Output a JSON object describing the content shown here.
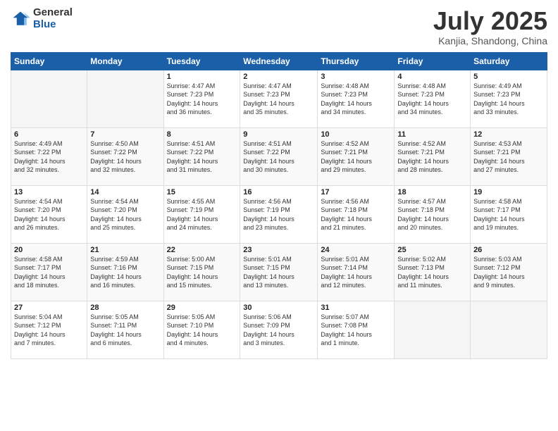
{
  "logo": {
    "general": "General",
    "blue": "Blue"
  },
  "header": {
    "month": "July 2025",
    "location": "Kanjia, Shandong, China"
  },
  "weekdays": [
    "Sunday",
    "Monday",
    "Tuesday",
    "Wednesday",
    "Thursday",
    "Friday",
    "Saturday"
  ],
  "weeks": [
    [
      {
        "day": "",
        "content": ""
      },
      {
        "day": "",
        "content": ""
      },
      {
        "day": "1",
        "content": "Sunrise: 4:47 AM\nSunset: 7:23 PM\nDaylight: 14 hours\nand 36 minutes."
      },
      {
        "day": "2",
        "content": "Sunrise: 4:47 AM\nSunset: 7:23 PM\nDaylight: 14 hours\nand 35 minutes."
      },
      {
        "day": "3",
        "content": "Sunrise: 4:48 AM\nSunset: 7:23 PM\nDaylight: 14 hours\nand 34 minutes."
      },
      {
        "day": "4",
        "content": "Sunrise: 4:48 AM\nSunset: 7:23 PM\nDaylight: 14 hours\nand 34 minutes."
      },
      {
        "day": "5",
        "content": "Sunrise: 4:49 AM\nSunset: 7:23 PM\nDaylight: 14 hours\nand 33 minutes."
      }
    ],
    [
      {
        "day": "6",
        "content": "Sunrise: 4:49 AM\nSunset: 7:22 PM\nDaylight: 14 hours\nand 32 minutes."
      },
      {
        "day": "7",
        "content": "Sunrise: 4:50 AM\nSunset: 7:22 PM\nDaylight: 14 hours\nand 32 minutes."
      },
      {
        "day": "8",
        "content": "Sunrise: 4:51 AM\nSunset: 7:22 PM\nDaylight: 14 hours\nand 31 minutes."
      },
      {
        "day": "9",
        "content": "Sunrise: 4:51 AM\nSunset: 7:22 PM\nDaylight: 14 hours\nand 30 minutes."
      },
      {
        "day": "10",
        "content": "Sunrise: 4:52 AM\nSunset: 7:21 PM\nDaylight: 14 hours\nand 29 minutes."
      },
      {
        "day": "11",
        "content": "Sunrise: 4:52 AM\nSunset: 7:21 PM\nDaylight: 14 hours\nand 28 minutes."
      },
      {
        "day": "12",
        "content": "Sunrise: 4:53 AM\nSunset: 7:21 PM\nDaylight: 14 hours\nand 27 minutes."
      }
    ],
    [
      {
        "day": "13",
        "content": "Sunrise: 4:54 AM\nSunset: 7:20 PM\nDaylight: 14 hours\nand 26 minutes."
      },
      {
        "day": "14",
        "content": "Sunrise: 4:54 AM\nSunset: 7:20 PM\nDaylight: 14 hours\nand 25 minutes."
      },
      {
        "day": "15",
        "content": "Sunrise: 4:55 AM\nSunset: 7:19 PM\nDaylight: 14 hours\nand 24 minutes."
      },
      {
        "day": "16",
        "content": "Sunrise: 4:56 AM\nSunset: 7:19 PM\nDaylight: 14 hours\nand 23 minutes."
      },
      {
        "day": "17",
        "content": "Sunrise: 4:56 AM\nSunset: 7:18 PM\nDaylight: 14 hours\nand 21 minutes."
      },
      {
        "day": "18",
        "content": "Sunrise: 4:57 AM\nSunset: 7:18 PM\nDaylight: 14 hours\nand 20 minutes."
      },
      {
        "day": "19",
        "content": "Sunrise: 4:58 AM\nSunset: 7:17 PM\nDaylight: 14 hours\nand 19 minutes."
      }
    ],
    [
      {
        "day": "20",
        "content": "Sunrise: 4:58 AM\nSunset: 7:17 PM\nDaylight: 14 hours\nand 18 minutes."
      },
      {
        "day": "21",
        "content": "Sunrise: 4:59 AM\nSunset: 7:16 PM\nDaylight: 14 hours\nand 16 minutes."
      },
      {
        "day": "22",
        "content": "Sunrise: 5:00 AM\nSunset: 7:15 PM\nDaylight: 14 hours\nand 15 minutes."
      },
      {
        "day": "23",
        "content": "Sunrise: 5:01 AM\nSunset: 7:15 PM\nDaylight: 14 hours\nand 13 minutes."
      },
      {
        "day": "24",
        "content": "Sunrise: 5:01 AM\nSunset: 7:14 PM\nDaylight: 14 hours\nand 12 minutes."
      },
      {
        "day": "25",
        "content": "Sunrise: 5:02 AM\nSunset: 7:13 PM\nDaylight: 14 hours\nand 11 minutes."
      },
      {
        "day": "26",
        "content": "Sunrise: 5:03 AM\nSunset: 7:12 PM\nDaylight: 14 hours\nand 9 minutes."
      }
    ],
    [
      {
        "day": "27",
        "content": "Sunrise: 5:04 AM\nSunset: 7:12 PM\nDaylight: 14 hours\nand 7 minutes."
      },
      {
        "day": "28",
        "content": "Sunrise: 5:05 AM\nSunset: 7:11 PM\nDaylight: 14 hours\nand 6 minutes."
      },
      {
        "day": "29",
        "content": "Sunrise: 5:05 AM\nSunset: 7:10 PM\nDaylight: 14 hours\nand 4 minutes."
      },
      {
        "day": "30",
        "content": "Sunrise: 5:06 AM\nSunset: 7:09 PM\nDaylight: 14 hours\nand 3 minutes."
      },
      {
        "day": "31",
        "content": "Sunrise: 5:07 AM\nSunset: 7:08 PM\nDaylight: 14 hours\nand 1 minute."
      },
      {
        "day": "",
        "content": ""
      },
      {
        "day": "",
        "content": ""
      }
    ]
  ]
}
